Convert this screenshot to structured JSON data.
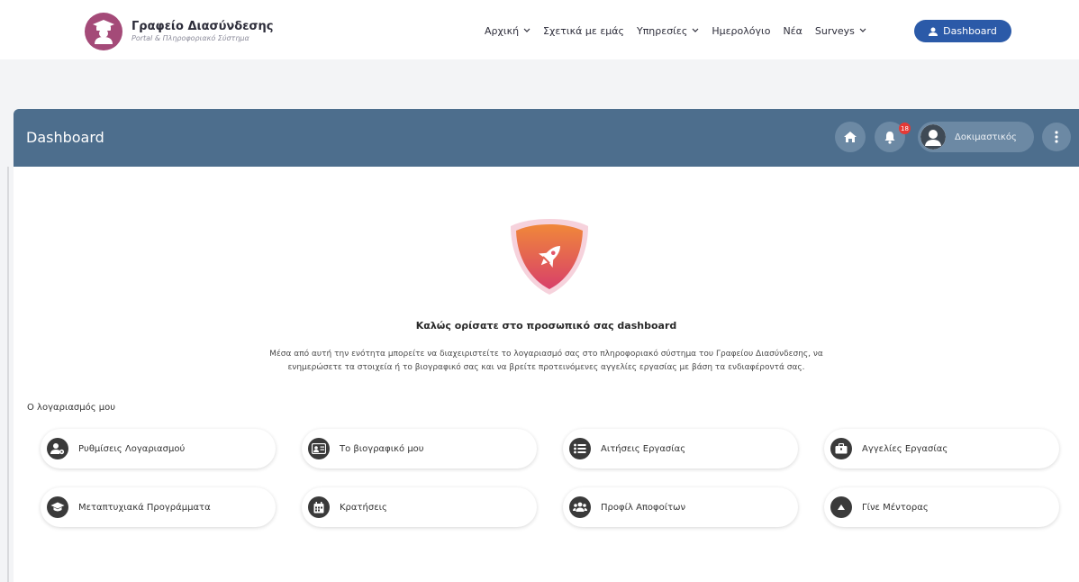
{
  "brand": {
    "title": "Γραφείο Διασύνδεσης",
    "subtitle": "Portal & Πληροφοριακό Σύστημα",
    "logo_color": "#a44a78"
  },
  "nav": {
    "items": [
      {
        "label": "Αρχική",
        "has_dropdown": true
      },
      {
        "label": "Σχετικά με εμάς",
        "has_dropdown": false
      },
      {
        "label": "Υπηρεσίες",
        "has_dropdown": true
      },
      {
        "label": "Ημερολόγιο",
        "has_dropdown": false
      },
      {
        "label": "Νέα",
        "has_dropdown": false
      },
      {
        "label": "Surveys",
        "has_dropdown": true
      }
    ],
    "dashboard_button": "Dashboard",
    "accent": "#2b5aa8"
  },
  "panel": {
    "title": "Dashboard",
    "header_color": "#4d6e8d",
    "notification_count": "18",
    "user_name": "Δοκιμαστικός",
    "icons": [
      "home-icon",
      "bell-icon",
      "user-icon",
      "more-vertical-icon"
    ]
  },
  "welcome": {
    "title": "Καλώς ορίσατε στο προσωπικό σας dashboard",
    "text_line1": "Μέσα από αυτή την ενότητα μπορείτε να διαχειριστείτε το λογαριασμό σας στο πληροφοριακό σύστημα του Γραφείου Διασύνδεσης, να",
    "text_line2": "ενημερώσετε τα στοιχεία ή το βιογραφικό σας και να βρείτε προτεινόμενες αγγελίες εργασίας με βάση τα ενδιαφέροντά σας."
  },
  "account": {
    "section_label": "Ο λογαριασμός μου",
    "tiles": [
      {
        "label": "Ρυθμίσεις Λογαριασμού",
        "icon": "user-settings-icon"
      },
      {
        "label": "Το βιογραφικό μου",
        "icon": "id-card-icon"
      },
      {
        "label": "Αιτήσεις Εργασίας",
        "icon": "list-icon"
      },
      {
        "label": "Αγγελίες Εργασίας",
        "icon": "briefcase-icon"
      },
      {
        "label": "Μεταπτυχιακά Προγράμματα",
        "icon": "graduation-cap-icon"
      },
      {
        "label": "Κρατήσεις",
        "icon": "calendar-icon"
      },
      {
        "label": "Προφίλ Αποφοίτων",
        "icon": "users-icon"
      },
      {
        "label": "Γίνε Μέντορας",
        "icon": "arrow-up-icon"
      }
    ]
  }
}
